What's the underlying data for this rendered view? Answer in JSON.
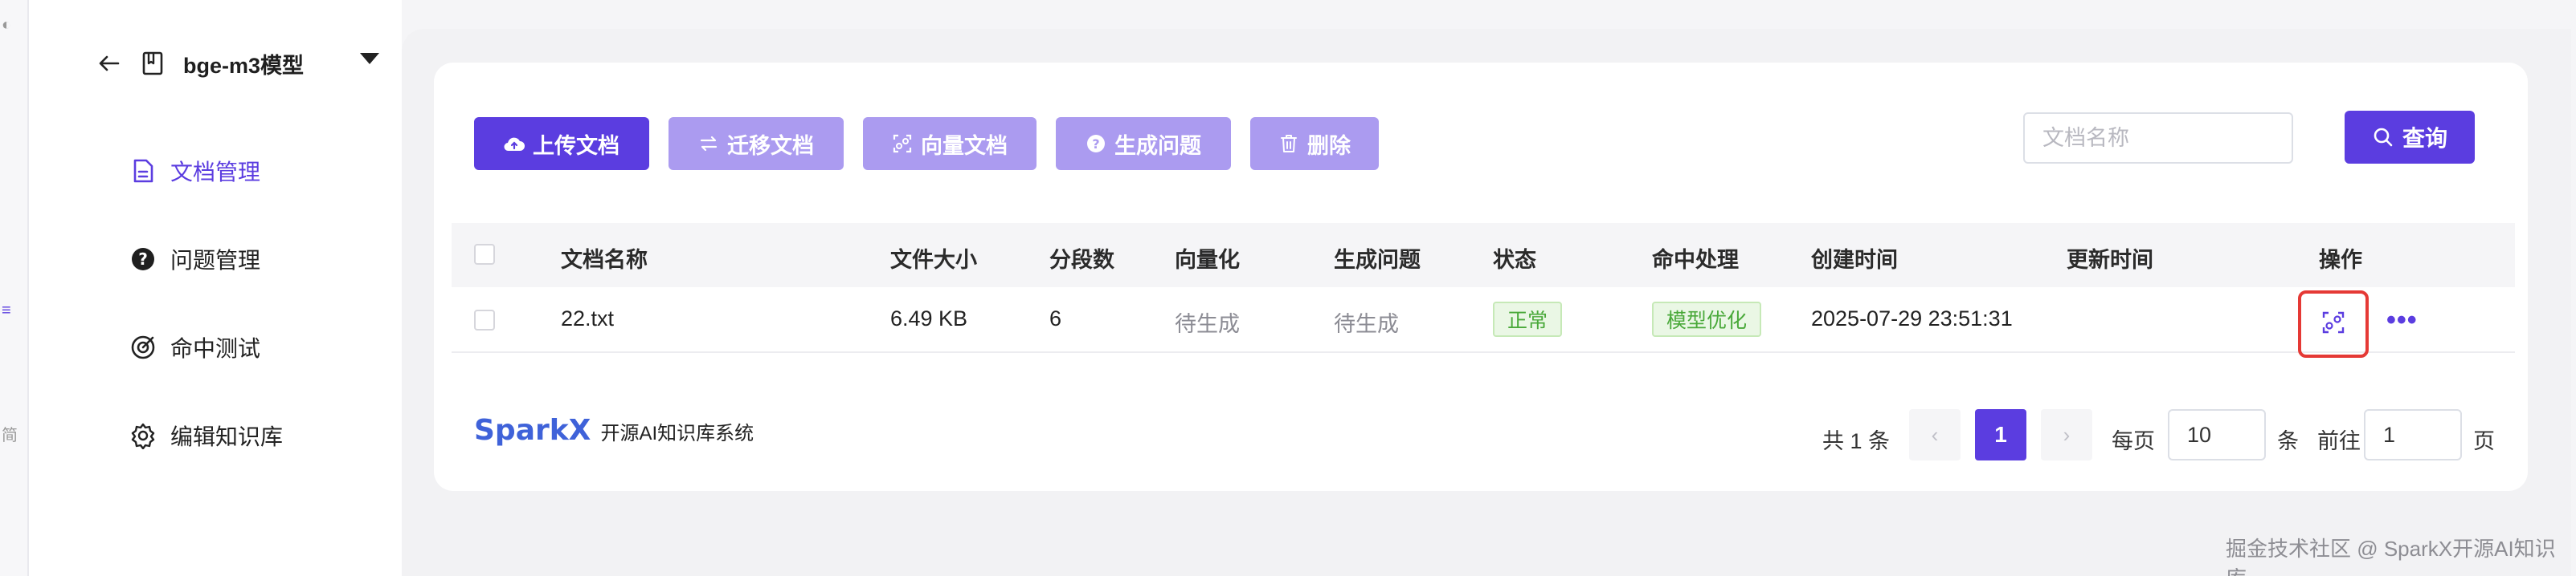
{
  "left_strip": {
    "glyph_top": "◐",
    "glyph_mid": "≡",
    "glyph_bottom": "简"
  },
  "sidebar": {
    "kb_name": "bge-m3模型",
    "items": [
      {
        "label": "文档管理",
        "active": true,
        "icon": "document-icon"
      },
      {
        "label": "问题管理",
        "active": false,
        "icon": "question-icon"
      },
      {
        "label": "命中测试",
        "active": false,
        "icon": "target-icon"
      },
      {
        "label": "编辑知识库",
        "active": false,
        "icon": "gear-icon"
      }
    ]
  },
  "toolbar": {
    "upload": "上传文档",
    "migrate": "迁移文档",
    "vectorize": "向量文档",
    "generate": "生成问题",
    "delete": "删除"
  },
  "search": {
    "placeholder": "文档名称",
    "button": "查询"
  },
  "table": {
    "columns": [
      "文档名称",
      "文件大小",
      "分段数",
      "向量化",
      "生成问题",
      "状态",
      "命中处理",
      "创建时间",
      "更新时间",
      "操作"
    ],
    "rows": [
      {
        "name": "22.txt",
        "size": "6.49 KB",
        "segments": "6",
        "vectorize": "待生成",
        "generate": "待生成",
        "status": "正常",
        "hit": "模型优化",
        "created": "2025-07-29 23:51:31",
        "updated": "",
        "more": "•••"
      }
    ]
  },
  "footer": {
    "brand": "SparkX",
    "brand_sub": "开源AI知识库系统",
    "total": "共 1 条",
    "current_page": "1",
    "per_page_label": "每页",
    "per_page_value": "10",
    "per_page_unit": "条",
    "goto_label": "前往",
    "goto_value": "1",
    "goto_unit": "页"
  },
  "watermark": "掘金技术社区 @ SparkX开源AI知识库",
  "colors": {
    "accent": "#5b3de0",
    "accent_disabled": "#ab9bf0",
    "success": "#4aa93a",
    "highlight": "#e53935",
    "brand": "#3f62d9"
  }
}
